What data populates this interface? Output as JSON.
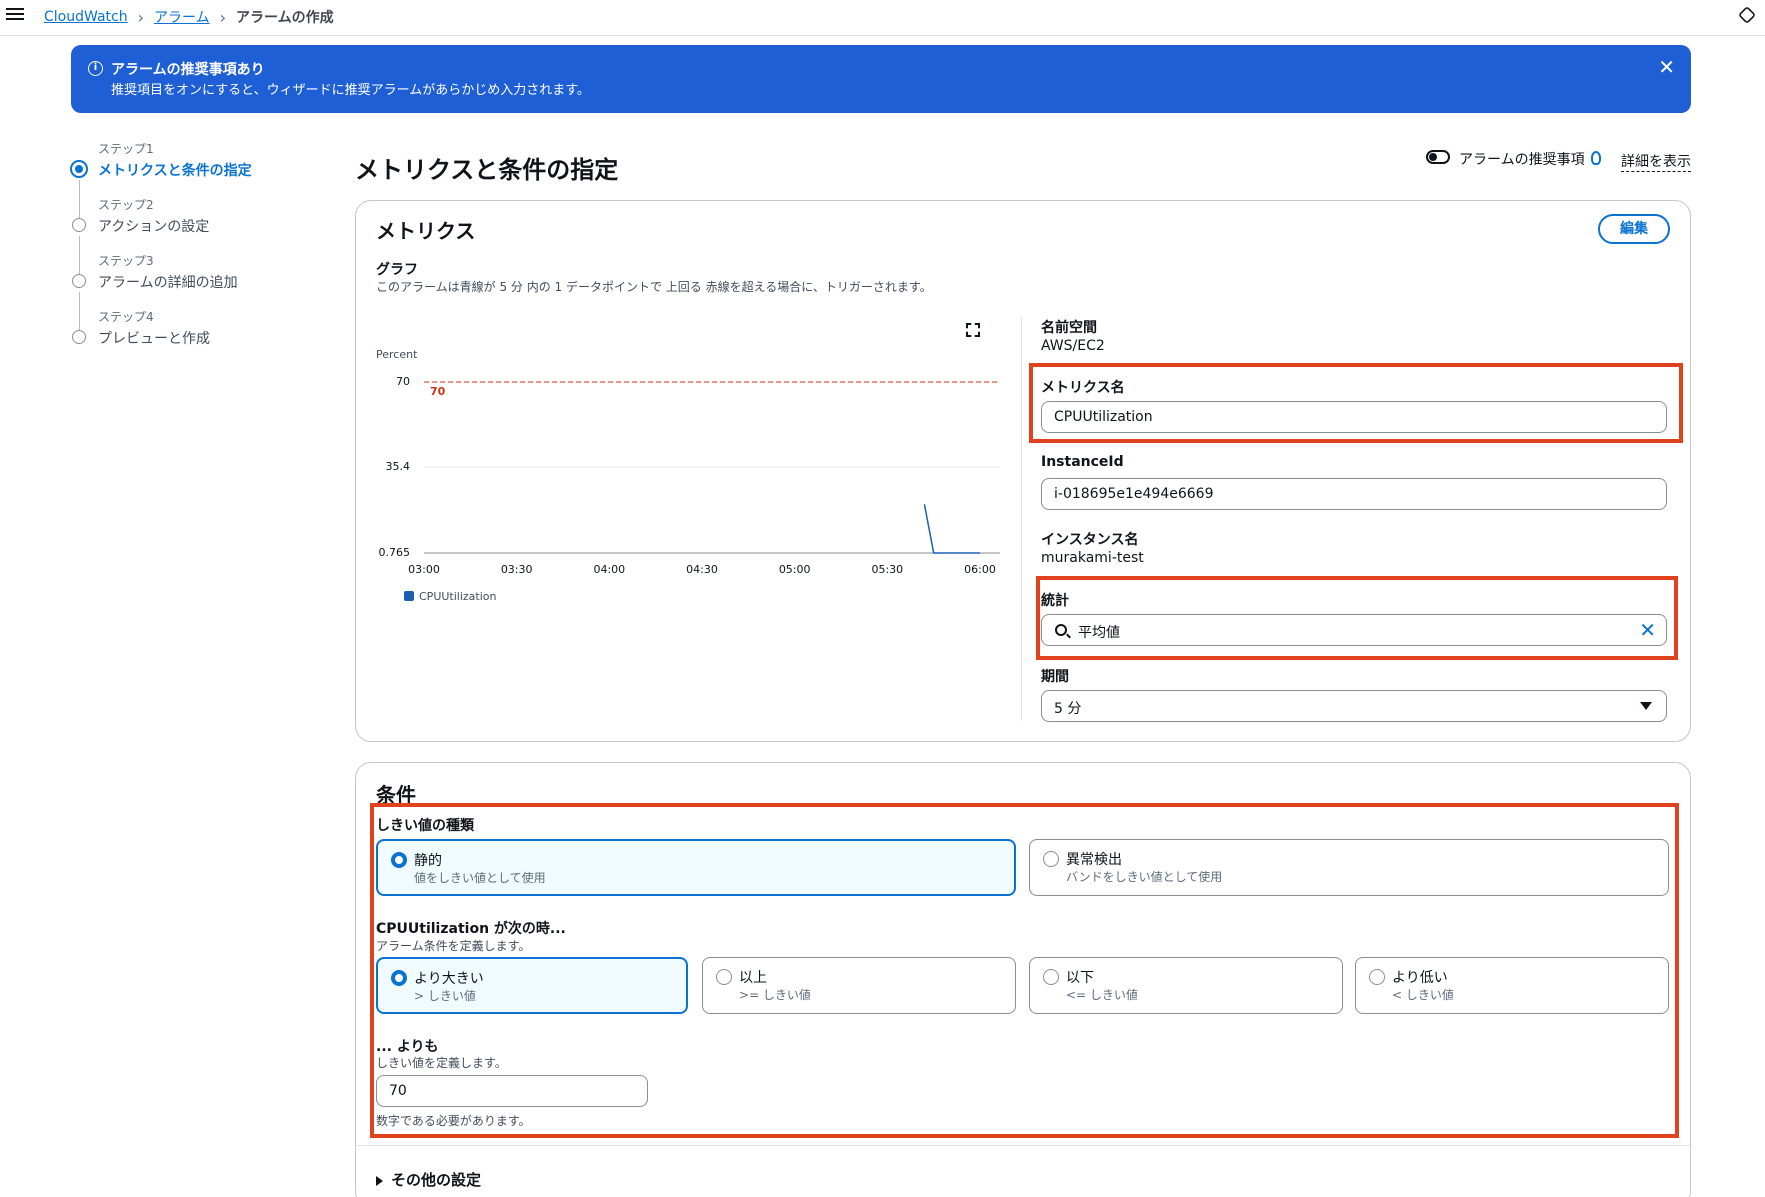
{
  "breadcrumb": {
    "root": "CloudWatch",
    "parent": "アラーム",
    "current": "アラームの作成"
  },
  "banner": {
    "title": "アラームの推奨事項あり",
    "text": "推奨項目をオンにすると、ウィザードに推奨アラームがあらかじめ入力されます。",
    "icon": "info-icon"
  },
  "steps": [
    {
      "num": "ステップ1",
      "label": "メトリクスと条件の指定",
      "active": true
    },
    {
      "num": "ステップ2",
      "label": "アクションの設定",
      "active": false
    },
    {
      "num": "ステップ3",
      "label": "アラームの詳細の追加",
      "active": false
    },
    {
      "num": "ステップ4",
      "label": "プレビューと作成",
      "active": false
    }
  ],
  "header": {
    "title": "メトリクスと条件の指定",
    "recommend_label": "アラームの推奨事項",
    "detail_link": "詳細を表示"
  },
  "metrics": {
    "title": "メトリクス",
    "edit_label": "編集",
    "graph_label": "グラフ",
    "graph_desc": "このアラームは青線が 5 分 内の 1 データポイントで 上回る 赤線を超える場合に、トリガーされます。",
    "namespace_label": "名前空間",
    "namespace_value": "AWS/EC2",
    "metric_name_label": "メトリクス名",
    "metric_name_value": "CPUUtilization",
    "instance_id_label": "InstanceId",
    "instance_id_value": "i-018695e1e494e6669",
    "instance_name_label": "インスタンス名",
    "instance_name_value": "murakami-test",
    "statistic_label": "統計",
    "statistic_value": "平均値",
    "period_label": "期間",
    "period_value": "5 分"
  },
  "chart_data": {
    "type": "line",
    "ylabel": "Percent",
    "y_ticks": [
      "70",
      "35.4",
      "0.765"
    ],
    "ylim": [
      0.765,
      70
    ],
    "x_ticks": [
      "03:00",
      "03:30",
      "04:00",
      "04:30",
      "05:00",
      "05:30",
      "06:00"
    ],
    "threshold": {
      "value": 70,
      "label": "70",
      "color": "#d13212"
    },
    "series": [
      {
        "name": "CPUUtilization",
        "color": "#1f5fb0",
        "x": [
          "05:42",
          "05:45",
          "05:50",
          "05:55",
          "06:00"
        ],
        "values": [
          20.5,
          0.77,
          0.77,
          0.77,
          0.77
        ]
      }
    ],
    "grid": true,
    "legend": "bottom-left"
  },
  "conditions": {
    "title": "条件",
    "threshold_type_label": "しきい値の種類",
    "threshold_types": [
      {
        "title": "静的",
        "sub": "値をしきい値として使用",
        "selected": true
      },
      {
        "title": "異常検出",
        "sub": "バンドをしきい値として使用",
        "selected": false
      }
    ],
    "when_label": "CPUUtilization が次の時...",
    "when_desc": "アラーム条件を定義します。",
    "operators": [
      {
        "title": "より大きい",
        "sub": "> しきい値",
        "selected": true
      },
      {
        "title": "以上",
        "sub": ">= しきい値",
        "selected": false
      },
      {
        "title": "以下",
        "sub": "<= しきい値",
        "selected": false
      },
      {
        "title": "より低い",
        "sub": "< しきい値",
        "selected": false
      }
    ],
    "than_label": "... よりも",
    "than_desc": "しきい値を定義します。",
    "threshold_value": "70",
    "threshold_hint": "数字である必要があります。",
    "other_settings": "その他の設定"
  },
  "colors": {
    "accent": "#0972d3",
    "banner": "#1f5fd6",
    "highlight": "#e0421d"
  }
}
